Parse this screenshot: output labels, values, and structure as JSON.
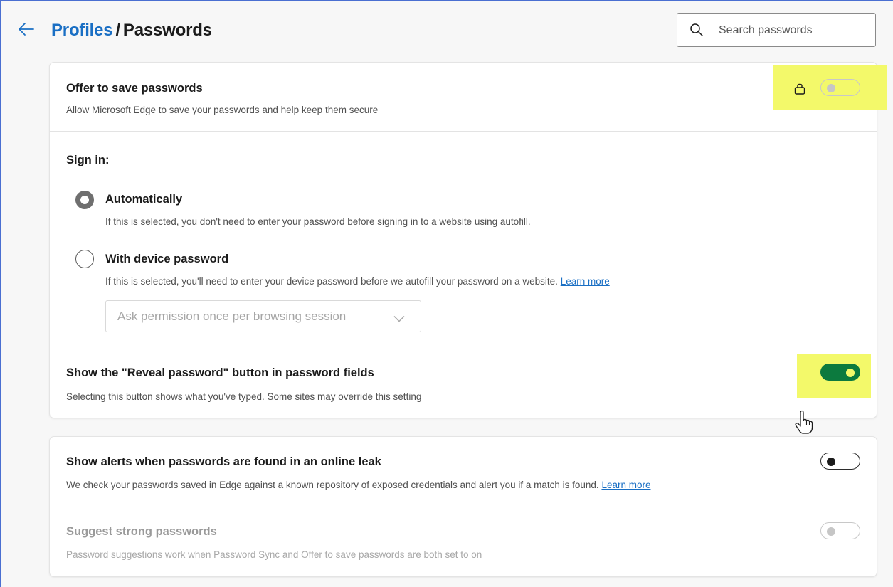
{
  "header": {
    "breadcrumb_parent": "Profiles",
    "breadcrumb_separator": "/",
    "breadcrumb_current": "Passwords",
    "search_placeholder": "Search passwords"
  },
  "offer_to_save": {
    "title": "Offer to save passwords",
    "description": "Allow Microsoft Edge to save your passwords and help keep them secure",
    "toggle_state": "off-disabled",
    "icon": "lock-icon"
  },
  "sign_in": {
    "heading": "Sign in:",
    "options": [
      {
        "label": "Automatically",
        "description": "If this is selected, you don't need to enter your password before signing in to a website using autofill.",
        "selected": true
      },
      {
        "label": "With device password",
        "description": "If this is selected, you'll need to enter your device password before we autofill your password on a website.",
        "link_text": "Learn more",
        "selected": false
      }
    ],
    "dropdown_value": "Ask permission once per browsing session"
  },
  "reveal_password": {
    "title": "Show the \"Reveal password\" button in password fields",
    "description": "Selecting this button shows what you've typed. Some sites may override this setting",
    "toggle_state": "on"
  },
  "leak_alerts": {
    "title": "Show alerts when passwords are found in an online leak",
    "description": "We check your passwords saved in Edge against a known repository of exposed credentials and alert you if a match is found.",
    "link_text": "Learn more",
    "toggle_state": "off"
  },
  "strong_passwords": {
    "title": "Suggest strong passwords",
    "description": "Password suggestions work when Password Sync and Offer to save passwords are both set to on",
    "toggle_state": "off-disabled"
  },
  "colors": {
    "accent": "#1a6fc4",
    "toggle_on": "#0c7a3e",
    "highlight": "#f3f96a"
  }
}
